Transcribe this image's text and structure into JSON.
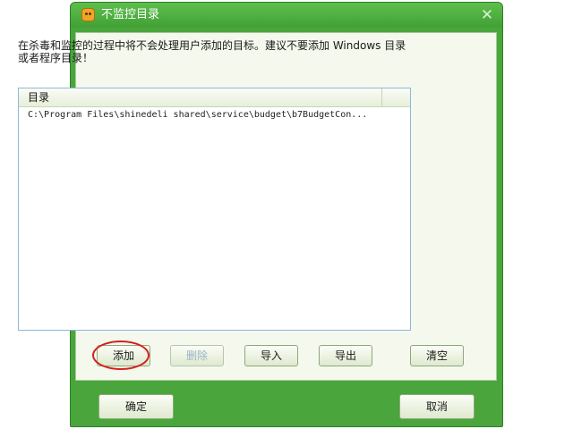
{
  "window": {
    "title": "不监控目录",
    "close_glyph": "✕"
  },
  "description": "在杀毒和监控的过程中将不会处理用户添加的目标。建议不要添加 Windows 目录或者程序目录！",
  "list": {
    "column_header": "目录",
    "rows": [
      "C:\\Program Files\\shinedeli shared\\service\\budget\\b7BudgetCon..."
    ]
  },
  "buttons": {
    "add": "添加",
    "delete": "删除",
    "import": "导入",
    "export": "导出",
    "clear": "清空",
    "ok": "确定",
    "cancel": "取消"
  },
  "colors": {
    "window_green": "#4aa63c",
    "highlight_circle": "#d42020"
  }
}
